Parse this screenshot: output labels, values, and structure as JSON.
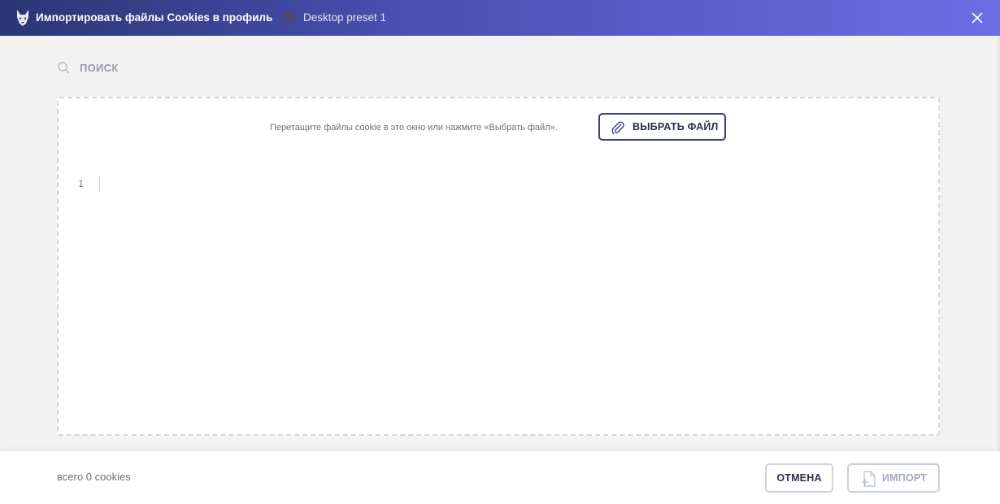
{
  "header": {
    "title": "Импортировать файлы Cookies в профиль",
    "preset": "Desktop preset 1",
    "logo_icon": "wolf-logo-icon",
    "preset_icon": "fingerprint-icon",
    "close_icon": "close-icon",
    "gradient_start": "#2c3574",
    "gradient_end": "#6a6fe6"
  },
  "search": {
    "placeholder": "ПОИСК",
    "value": "",
    "icon": "search-icon"
  },
  "dropzone": {
    "hint": "Перетащите файлы cookie в это окно или нажмите «Выбрать файл».",
    "choose_button": "ВЫБРАТЬ ФАЙЛ",
    "choose_icon": "paperclip-icon",
    "line_number": "1",
    "content": ""
  },
  "footer": {
    "count": "всего 0 cookies",
    "cancel_button": "ОТМЕНА",
    "import_button": "ИМПОРТ",
    "import_icon": "file-add-icon",
    "accent": "#3b3f80"
  }
}
